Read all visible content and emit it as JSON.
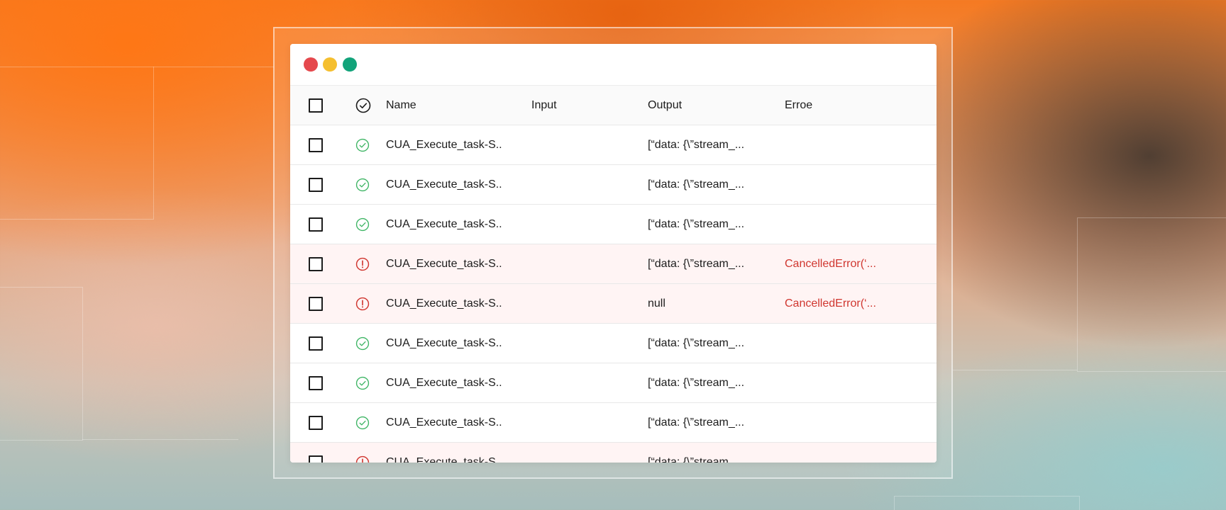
{
  "colors": {
    "close": "#e5484d",
    "minimize": "#f5bf2f",
    "maximize": "#12a37a",
    "success": "#3fb565",
    "error": "#d0362f"
  },
  "table": {
    "columns": {
      "name": "Name",
      "input": "Input",
      "output": "Output",
      "error": "Erroe"
    },
    "rows": [
      {
        "status": "success",
        "name": "CUA_Execute_task-S..",
        "input": "",
        "output": "[“data: {\\”stream_...",
        "error": ""
      },
      {
        "status": "success",
        "name": "CUA_Execute_task-S..",
        "input": "",
        "output": "[“data: {\\”stream_...",
        "error": ""
      },
      {
        "status": "success",
        "name": "CUA_Execute_task-S..",
        "input": "",
        "output": "[“data: {\\”stream_...",
        "error": ""
      },
      {
        "status": "error",
        "name": "CUA_Execute_task-S..",
        "input": "",
        "output": "[“data: {\\”stream_...",
        "error": "CancelledError(‘..."
      },
      {
        "status": "error",
        "name": "CUA_Execute_task-S..",
        "input": "",
        "output": "null",
        "error": "CancelledError(‘..."
      },
      {
        "status": "success",
        "name": "CUA_Execute_task-S..",
        "input": "",
        "output": "[“data: {\\”stream_...",
        "error": ""
      },
      {
        "status": "success",
        "name": "CUA_Execute_task-S..",
        "input": "",
        "output": "[“data: {\\”stream_...",
        "error": ""
      },
      {
        "status": "success",
        "name": "CUA_Execute_task-S..",
        "input": "",
        "output": "[“data: {\\”stream_...",
        "error": ""
      },
      {
        "status": "error",
        "name": "CUA_Execute_task-S..",
        "input": "",
        "output": "[“data: {\\”stream_...",
        "error": ""
      }
    ]
  }
}
